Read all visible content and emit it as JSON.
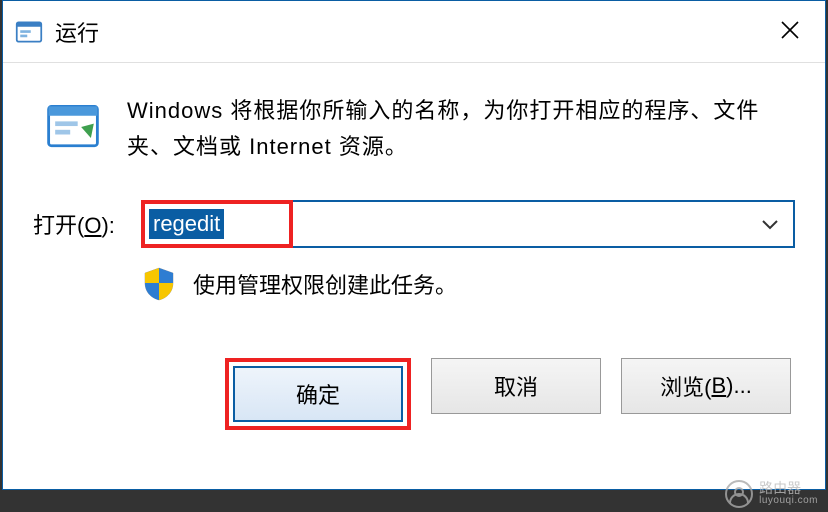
{
  "title": "运行",
  "description": "Windows 将根据你所输入的名称，为你打开相应的程序、文件夹、文档或 Internet 资源。",
  "open_label_prefix": "打开(",
  "open_label_key": "O",
  "open_label_suffix": "):",
  "input_value": "regedit",
  "admin_note": "使用管理权限创建此任务。",
  "buttons": {
    "ok": "确定",
    "cancel": "取消",
    "browse_prefix": "浏览(",
    "browse_key": "B",
    "browse_suffix": ")..."
  },
  "watermark": {
    "name": "路由器",
    "sub": "luyouqi.com"
  }
}
